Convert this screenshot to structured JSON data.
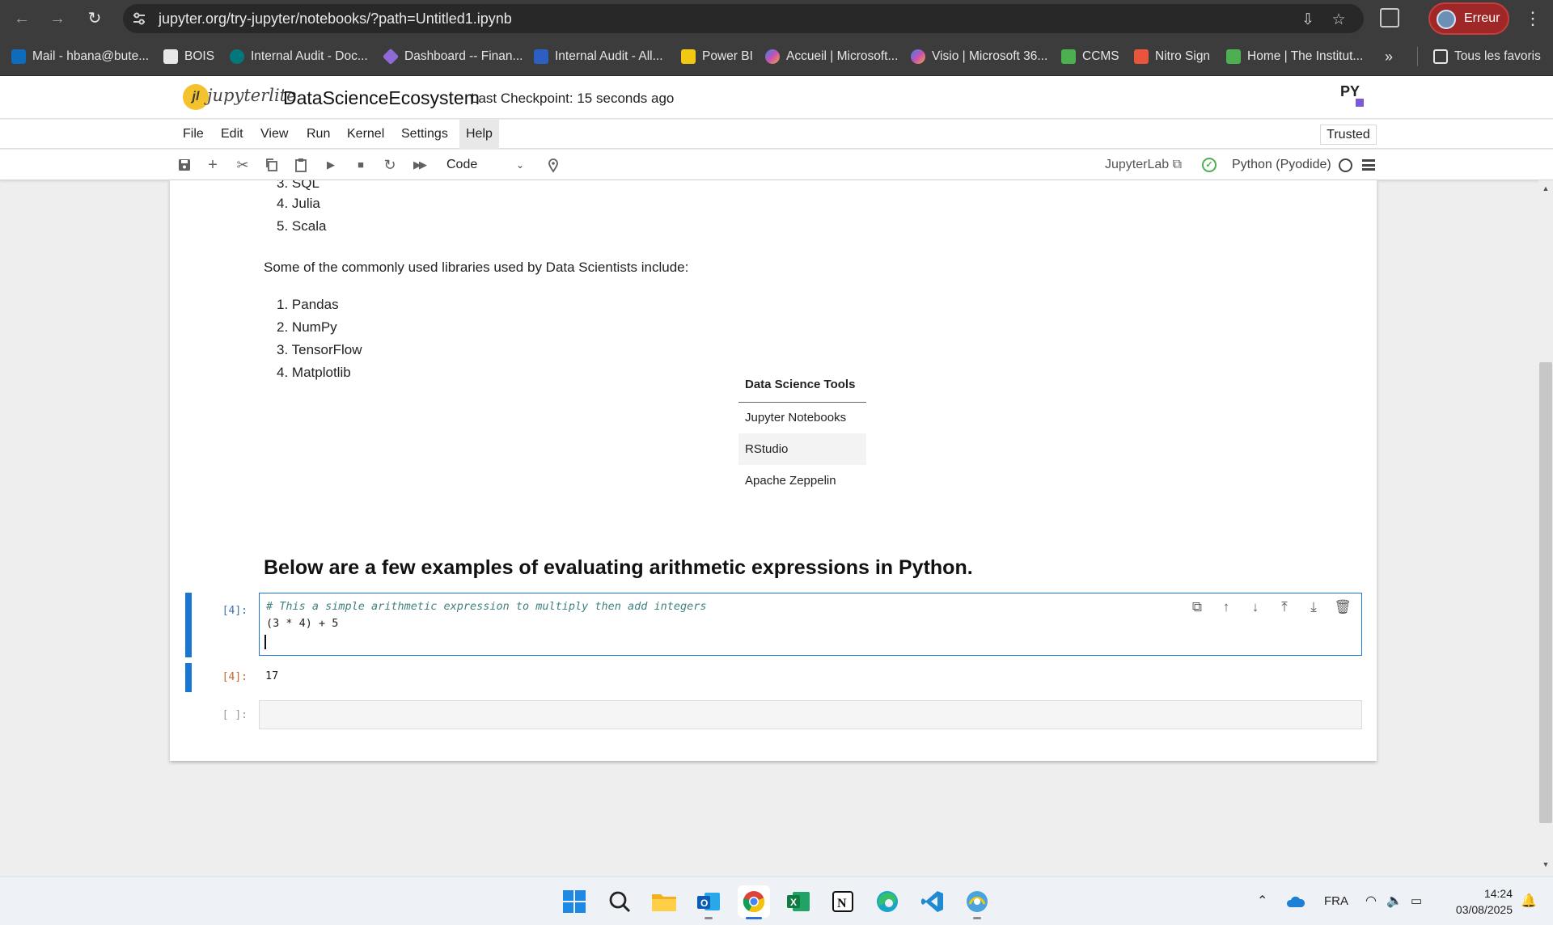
{
  "browser": {
    "url": "jupyter.org/try-jupyter/notebooks/?path=Untitled1.ipynb",
    "profile_label": "Erreur",
    "bookmarks": [
      {
        "label": "Mail - hbana@bute...",
        "icon": "outlook-icon",
        "color": "#0f6cbd"
      },
      {
        "label": "BOIS",
        "icon": "document-icon",
        "color": "#e8e8e8"
      },
      {
        "label": "Internal Audit - Doc...",
        "icon": "sharepoint-icon",
        "color": "#03787c"
      },
      {
        "label": "Dashboard -- Finan...",
        "icon": "diamond-icon",
        "color": "#8e6ad8"
      },
      {
        "label": "Internal Audit - All...",
        "icon": "sharepoint-icon",
        "color": "#2b5fc4"
      },
      {
        "label": "Power BI",
        "icon": "powerbi-icon",
        "color": "#f2c811"
      },
      {
        "label": "Accueil | Microsoft...",
        "icon": "microsoft365-icon",
        "color": "#c84fb6"
      },
      {
        "label": "Visio | Microsoft 36...",
        "icon": "microsoft365-icon",
        "color": "#c84fb6"
      },
      {
        "label": "CCMS",
        "icon": "ccms-icon",
        "color": "#4caf50"
      },
      {
        "label": "Nitro Sign",
        "icon": "nitro-icon",
        "color": "#e8553a"
      },
      {
        "label": "Home | The Institut...",
        "icon": "institute-icon",
        "color": "#4caf50"
      }
    ],
    "favorites_label": "Tous les favoris"
  },
  "jupyter": {
    "logo_text": "jupyterlite",
    "notebook_title": "DataScienceEcosystem",
    "checkpoint": "Last Checkpoint: 15 seconds ago",
    "menu": [
      "File",
      "Edit",
      "View",
      "Run",
      "Kernel",
      "Settings",
      "Help"
    ],
    "trusted": "Trusted",
    "cell_type": "Code",
    "jupyterlab_link": "JupyterLab",
    "kernel_name": "Python (Pyodide)",
    "py_logo_text": "PY"
  },
  "notebook": {
    "languages_visible": [
      {
        "num": "3.",
        "text": "SQL"
      },
      {
        "num": "4.",
        "text": "Julia"
      },
      {
        "num": "5.",
        "text": "Scala"
      }
    ],
    "libraries_intro": "Some of the commonly used libraries used by Data Scientists include:",
    "libraries": [
      {
        "num": "1.",
        "text": "Pandas"
      },
      {
        "num": "2.",
        "text": "NumPy"
      },
      {
        "num": "3.",
        "text": "TensorFlow"
      },
      {
        "num": "4.",
        "text": "Matplotlib"
      }
    ],
    "tools_header": "Data Science Tools",
    "tools": [
      "Jupyter Notebooks",
      "RStudio",
      "Apache Zeppelin"
    ],
    "heading": "Below are a few examples of evaluating arithmetic expressions in Python.",
    "code_cell": {
      "prompt": "[4]:",
      "comment": "# This a simple arithmetic expression to multiply then add integers",
      "code": "(3 * 4) + 5"
    },
    "output": {
      "prompt": "[4]:",
      "value": "17"
    },
    "empty_prompt": "[ ]:"
  },
  "taskbar": {
    "language": "FRA",
    "time": "14:24",
    "date": "03/08/2025"
  }
}
